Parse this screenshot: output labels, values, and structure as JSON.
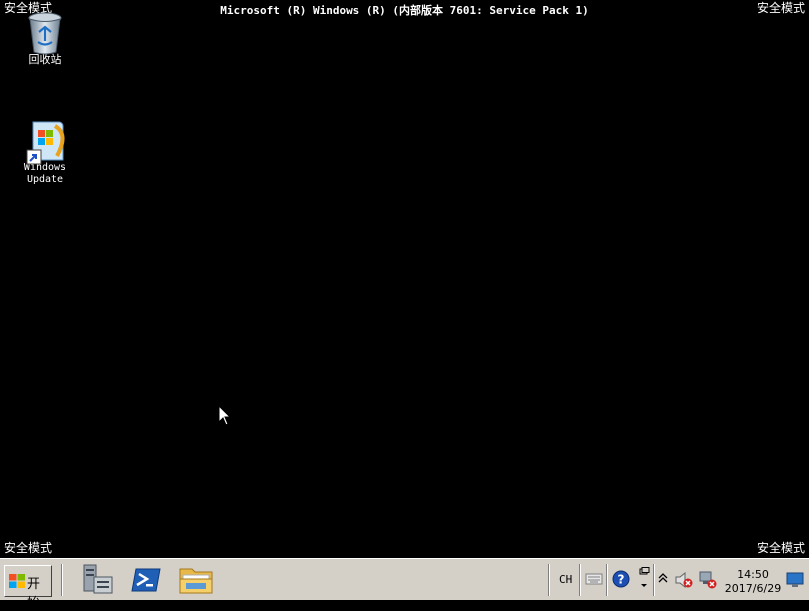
{
  "safe_mode": {
    "top_left": "安全模式",
    "top_right": "安全模式",
    "bottom_left": "安全模式",
    "bottom_right": "安全模式"
  },
  "build_info": "Microsoft (R) Windows (R) (内部版本 7601: Service Pack 1)",
  "desktop": {
    "icons": [
      {
        "label": "回收站",
        "icon": "recycle-bin-icon"
      },
      {
        "label_line1": "Windows",
        "label_line2": "Update",
        "icon": "windows-update-icon"
      }
    ]
  },
  "taskbar": {
    "start_label": "开始",
    "pinned": [
      {
        "icon": "server-manager-icon"
      },
      {
        "icon": "powershell-icon"
      },
      {
        "icon": "explorer-folder-icon"
      }
    ],
    "tray": {
      "language": "CH",
      "time": "14:50",
      "date": "2017/6/29"
    }
  },
  "colors": {
    "desktop": "#000000",
    "taskbar": "#d4d0c8"
  }
}
